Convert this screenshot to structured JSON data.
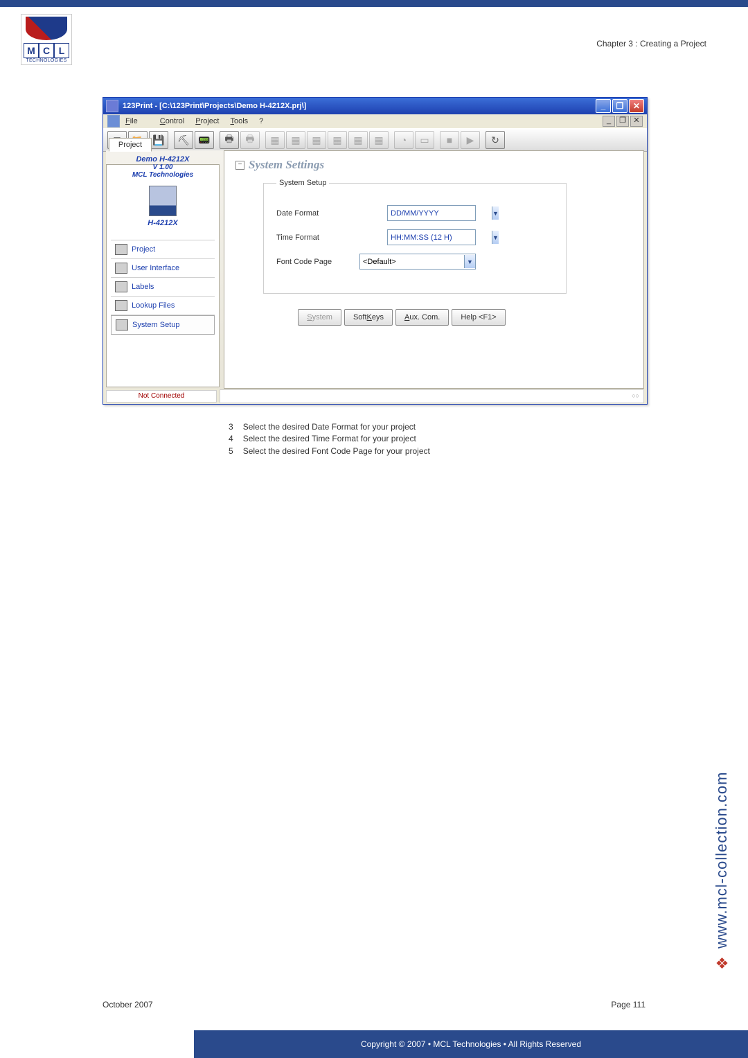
{
  "logo": {
    "letters": [
      "M",
      "C",
      "L"
    ],
    "sub": "TECHNOLOGIES"
  },
  "chapter": "Chapter 3 : Creating a Project",
  "appwin": {
    "title": "123Print - [C:\\123Print\\Projects\\Demo H-4212X.prj\\]",
    "minimize": "_",
    "maximize": "❐",
    "close": "✕",
    "childctrl": {
      "min": "_",
      "restore": "❐",
      "close": "✕"
    }
  },
  "menu": {
    "file": "File",
    "control": "Control",
    "project": "Project",
    "tools": "Tools",
    "help": "?"
  },
  "sidebar": {
    "tab": "Project",
    "project": {
      "name": "Demo H-4212X",
      "version": "V 1.00",
      "vendor": "MCL Technologies",
      "device": "H-4212X"
    },
    "nav": [
      {
        "label": "Project"
      },
      {
        "label": "User Interface"
      },
      {
        "label": "Labels"
      },
      {
        "label": "Lookup Files"
      },
      {
        "label": "System Setup"
      }
    ]
  },
  "main": {
    "heading": "System Settings",
    "legend": "System Setup",
    "date_label": "Date Format",
    "date_value": "DD/MM/YYYY",
    "time_label": "Time Format",
    "time_value": "HH:MM:SS (12 H)",
    "codepage_label": "Font Code Page",
    "codepage_value": "<Default>",
    "btn_system": "System",
    "btn_softkeys": "Soft Keys",
    "btn_aux": "Aux. Com.",
    "btn_help": "Help <F1>"
  },
  "status": {
    "left": "Not Connected",
    "right": "○○"
  },
  "instructions": [
    {
      "n": "3",
      "t": "Select the desired Date Format for your project"
    },
    {
      "n": "4",
      "t": "Select the desired Time Format for your project"
    },
    {
      "n": "5",
      "t": "Select the desired Font Code Page for your project"
    }
  ],
  "vurl": "www.mcl-collection.com",
  "footer": {
    "date": "October 2007",
    "page": "Page 111"
  },
  "copyright": "Copyright © 2007 • MCL Technologies • All Rights Reserved"
}
